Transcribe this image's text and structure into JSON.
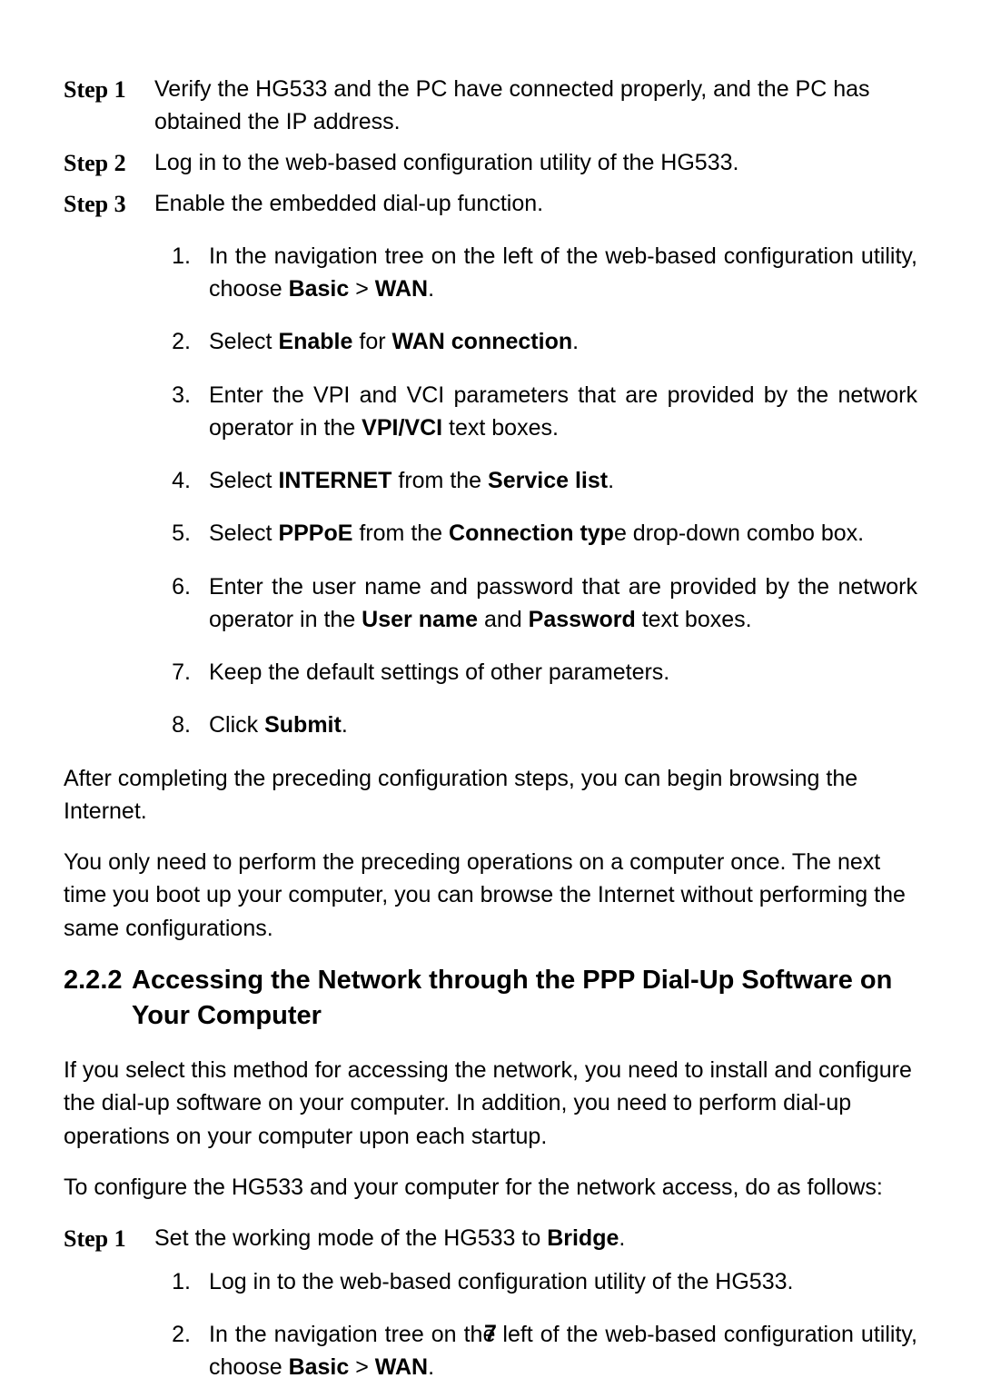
{
  "steps_a": [
    {
      "label": "Step 1",
      "text": "Verify the HG533 and the PC have connected properly, and the PC has obtained the IP address."
    },
    {
      "label": "Step 2",
      "text": "Log in to the web-based configuration utility of the HG533."
    },
    {
      "label": "Step 3",
      "text": "Enable the embedded dial-up function."
    }
  ],
  "list_a": {
    "1": {
      "pre": "In the navigation tree on the left of the web-based configuration utility, choose ",
      "b1": "Basic",
      "mid": " > ",
      "b2": "WAN",
      "post": "."
    },
    "2": {
      "pre": "Select ",
      "b1": "Enable",
      "mid": " for ",
      "b2": "WAN connection",
      "post": "."
    },
    "3": {
      "pre": "Enter the VPI and VCI parameters that are provided by the network operator in the ",
      "b1": "VPI/VCI",
      "post": " text boxes."
    },
    "4": {
      "pre": "Select ",
      "b1": "INTERNET",
      "mid": " from the ",
      "b2": "Service list",
      "post": "."
    },
    "5": {
      "pre": "Select ",
      "b1": "PPPoE",
      "mid": " from the ",
      "b2": "Connection typ",
      "post_plain": "e drop-down combo box."
    },
    "6": {
      "pre": "Enter the user name and password that are provided by the network operator in the ",
      "b1": "User name",
      "mid": " and ",
      "b2": "Password",
      "post": " text boxes."
    },
    "7": {
      "pre": "Keep the default settings of other parameters."
    },
    "8": {
      "pre": "Click ",
      "b1": "Submit",
      "post": "."
    }
  },
  "para1": "After completing the preceding configuration steps, you can begin browsing the Internet.",
  "para2": "You only need to perform the preceding operations on a computer once. The next time you boot up your computer, you can browse the Internet without performing the same configurations.",
  "heading": {
    "num": "2.2.2",
    "text": "Accessing the Network through the PPP Dial-Up Software on Your Computer"
  },
  "para3": "If you select this method for accessing the network, you need to install and configure the dial-up software on your computer. In addition, you need to perform dial-up operations on your computer upon each startup.",
  "para4": "To configure the HG533 and your computer for the network access, do as follows:",
  "steps_b": {
    "label": "Step 1",
    "pre": "Set the working mode of the HG533 to ",
    "b1": "Bridge",
    "post": "."
  },
  "list_b": {
    "1": {
      "pre": "Log in to the web-based configuration utility of the HG533."
    },
    "2": {
      "pre": "In the navigation tree on the left of the web-based configuration utility, choose ",
      "b1": "Basic",
      "mid": " > ",
      "b2": "WAN",
      "post": "."
    }
  },
  "page_number": "7"
}
